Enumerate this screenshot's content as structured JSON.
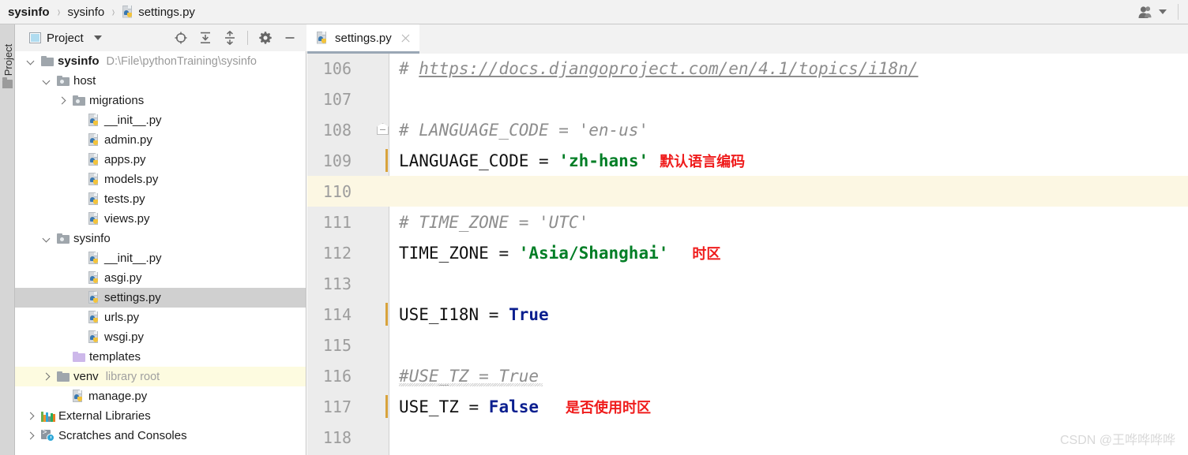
{
  "breadcrumb": {
    "items": [
      {
        "label": "sysinfo",
        "bold": true,
        "icon": null
      },
      {
        "label": "sysinfo",
        "bold": false,
        "icon": null
      },
      {
        "label": "settings.py",
        "bold": false,
        "icon": "python-file-icon"
      }
    ],
    "separator": "›"
  },
  "topbar_right": {
    "account_icon": "users-icon",
    "dropdown_icon": "chevron-down-icon"
  },
  "tool_strip": {
    "label": "Project",
    "icon": "folder-icon"
  },
  "project_panel": {
    "title": "Project",
    "title_icon": "window-icon",
    "dropdown_icon": "chevron-down-icon",
    "tools": [
      {
        "name": "select-opened-file-icon",
        "title": "Select Opened File"
      },
      {
        "name": "expand-all-icon",
        "title": "Expand All"
      },
      {
        "name": "collapse-all-icon",
        "title": "Collapse All"
      },
      {
        "name": "settings-gear-icon",
        "title": "Settings"
      },
      {
        "name": "hide-icon",
        "title": "Hide"
      }
    ],
    "tree": [
      {
        "label": "sysinfo",
        "note": "D:\\File\\pythonTraining\\sysinfo",
        "indent": 0,
        "arrow": "down",
        "icon": "folder",
        "bold": true,
        "state": "normal"
      },
      {
        "label": "host",
        "note": "",
        "indent": 1,
        "arrow": "down",
        "icon": "module-folder",
        "bold": false,
        "state": "normal"
      },
      {
        "label": "migrations",
        "note": "",
        "indent": 2,
        "arrow": "right",
        "icon": "module-folder",
        "bold": false,
        "state": "normal"
      },
      {
        "label": "__init__.py",
        "note": "",
        "indent": 3,
        "arrow": "none",
        "icon": "python-file",
        "bold": false,
        "state": "normal"
      },
      {
        "label": "admin.py",
        "note": "",
        "indent": 3,
        "arrow": "none",
        "icon": "python-file",
        "bold": false,
        "state": "normal"
      },
      {
        "label": "apps.py",
        "note": "",
        "indent": 3,
        "arrow": "none",
        "icon": "python-file",
        "bold": false,
        "state": "normal"
      },
      {
        "label": "models.py",
        "note": "",
        "indent": 3,
        "arrow": "none",
        "icon": "python-file",
        "bold": false,
        "state": "normal"
      },
      {
        "label": "tests.py",
        "note": "",
        "indent": 3,
        "arrow": "none",
        "icon": "python-file",
        "bold": false,
        "state": "normal"
      },
      {
        "label": "views.py",
        "note": "",
        "indent": 3,
        "arrow": "none",
        "icon": "python-file",
        "bold": false,
        "state": "normal"
      },
      {
        "label": "sysinfo",
        "note": "",
        "indent": 1,
        "arrow": "down",
        "icon": "module-folder",
        "bold": false,
        "state": "normal"
      },
      {
        "label": "__init__.py",
        "note": "",
        "indent": 3,
        "arrow": "none",
        "icon": "python-file",
        "bold": false,
        "state": "normal"
      },
      {
        "label": "asgi.py",
        "note": "",
        "indent": 3,
        "arrow": "none",
        "icon": "python-file",
        "bold": false,
        "state": "normal"
      },
      {
        "label": "settings.py",
        "note": "",
        "indent": 3,
        "arrow": "none",
        "icon": "python-file",
        "bold": false,
        "state": "selected"
      },
      {
        "label": "urls.py",
        "note": "",
        "indent": 3,
        "arrow": "none",
        "icon": "python-file",
        "bold": false,
        "state": "normal"
      },
      {
        "label": "wsgi.py",
        "note": "",
        "indent": 3,
        "arrow": "none",
        "icon": "python-file",
        "bold": false,
        "state": "normal"
      },
      {
        "label": "templates",
        "note": "",
        "indent": 2,
        "arrow": "none",
        "icon": "purple-folder",
        "bold": false,
        "state": "normal"
      },
      {
        "label": "venv",
        "note": "library root",
        "indent": 1,
        "arrow": "right",
        "icon": "folder",
        "bold": false,
        "state": "highlight"
      },
      {
        "label": "manage.py",
        "note": "",
        "indent": 2,
        "arrow": "none",
        "icon": "python-file",
        "bold": false,
        "state": "normal"
      },
      {
        "label": "External Libraries",
        "note": "",
        "indent": 0,
        "arrow": "right",
        "icon": "libraries",
        "bold": false,
        "state": "normal"
      },
      {
        "label": "Scratches and Consoles",
        "note": "",
        "indent": 0,
        "arrow": "right",
        "icon": "scratches",
        "bold": false,
        "state": "normal"
      }
    ]
  },
  "editor": {
    "tabs": [
      {
        "label": "settings.py",
        "icon": "python-file-icon",
        "active": true,
        "close_icon": "close-icon"
      }
    ],
    "first_line_number": 106,
    "current_line": 110,
    "lines": [
      {
        "num": 106,
        "fold": false,
        "changebar": false,
        "tokens": [
          {
            "t": "# ",
            "c": "cmt"
          },
          {
            "t": "https://docs.djangoproject.com/en/4.1/topics/i18n/",
            "c": "cmt link"
          }
        ],
        "annotation": ""
      },
      {
        "num": 107,
        "fold": false,
        "changebar": false,
        "tokens": [],
        "annotation": ""
      },
      {
        "num": 108,
        "fold": true,
        "changebar": false,
        "tokens": [
          {
            "t": "# LANGUAGE_CODE = 'en-us'",
            "c": "cmt"
          }
        ],
        "annotation": ""
      },
      {
        "num": 109,
        "fold": false,
        "changebar": true,
        "tokens": [
          {
            "t": "LANGUAGE_CODE",
            "c": "idt"
          },
          {
            "t": " = ",
            "c": "op"
          },
          {
            "t": "'zh-hans'",
            "c": "str"
          }
        ],
        "annotation": "默认语言编码"
      },
      {
        "num": 110,
        "fold": false,
        "changebar": false,
        "tokens": [],
        "annotation": ""
      },
      {
        "num": 111,
        "fold": false,
        "changebar": false,
        "tokens": [
          {
            "t": "# TIME_ZONE = 'UTC'",
            "c": "cmt"
          }
        ],
        "annotation": ""
      },
      {
        "num": 112,
        "fold": false,
        "changebar": false,
        "tokens": [
          {
            "t": "TIME_ZONE",
            "c": "idt"
          },
          {
            "t": " = ",
            "c": "op"
          },
          {
            "t": "'Asia/Shanghai'",
            "c": "str"
          }
        ],
        "annotation": "时区"
      },
      {
        "num": 113,
        "fold": false,
        "changebar": false,
        "tokens": [],
        "annotation": ""
      },
      {
        "num": 114,
        "fold": false,
        "changebar": true,
        "tokens": [
          {
            "t": "USE_I18N",
            "c": "idt"
          },
          {
            "t": " = ",
            "c": "op"
          },
          {
            "t": "True",
            "c": "bool"
          }
        ],
        "annotation": ""
      },
      {
        "num": 115,
        "fold": false,
        "changebar": false,
        "tokens": [],
        "annotation": ""
      },
      {
        "num": 116,
        "fold": false,
        "changebar": false,
        "squiggle": true,
        "tokens": [
          {
            "t": "#USE_TZ = True",
            "c": "cmt"
          }
        ],
        "annotation": ""
      },
      {
        "num": 117,
        "fold": false,
        "changebar": true,
        "tokens": [
          {
            "t": "USE_TZ",
            "c": "idt"
          },
          {
            "t": " = ",
            "c": "op"
          },
          {
            "t": "False",
            "c": "bool"
          }
        ],
        "annotation": "是否使用时区"
      },
      {
        "num": 118,
        "fold": false,
        "changebar": false,
        "tokens": [],
        "annotation": ""
      }
    ]
  },
  "watermark": "CSDN @王哗哗哗哗",
  "colors": {
    "string_green": "#027e26",
    "keyword_blue": "#0b1f8f",
    "annotation_red": "#ef1c1c",
    "comment_gray": "#8d8d8d",
    "current_line": "#fcf7e3",
    "selection_gray": "#d0d0d0",
    "highlight_yellow": "#fdfbe0",
    "change_bar": "#d8a33c"
  }
}
